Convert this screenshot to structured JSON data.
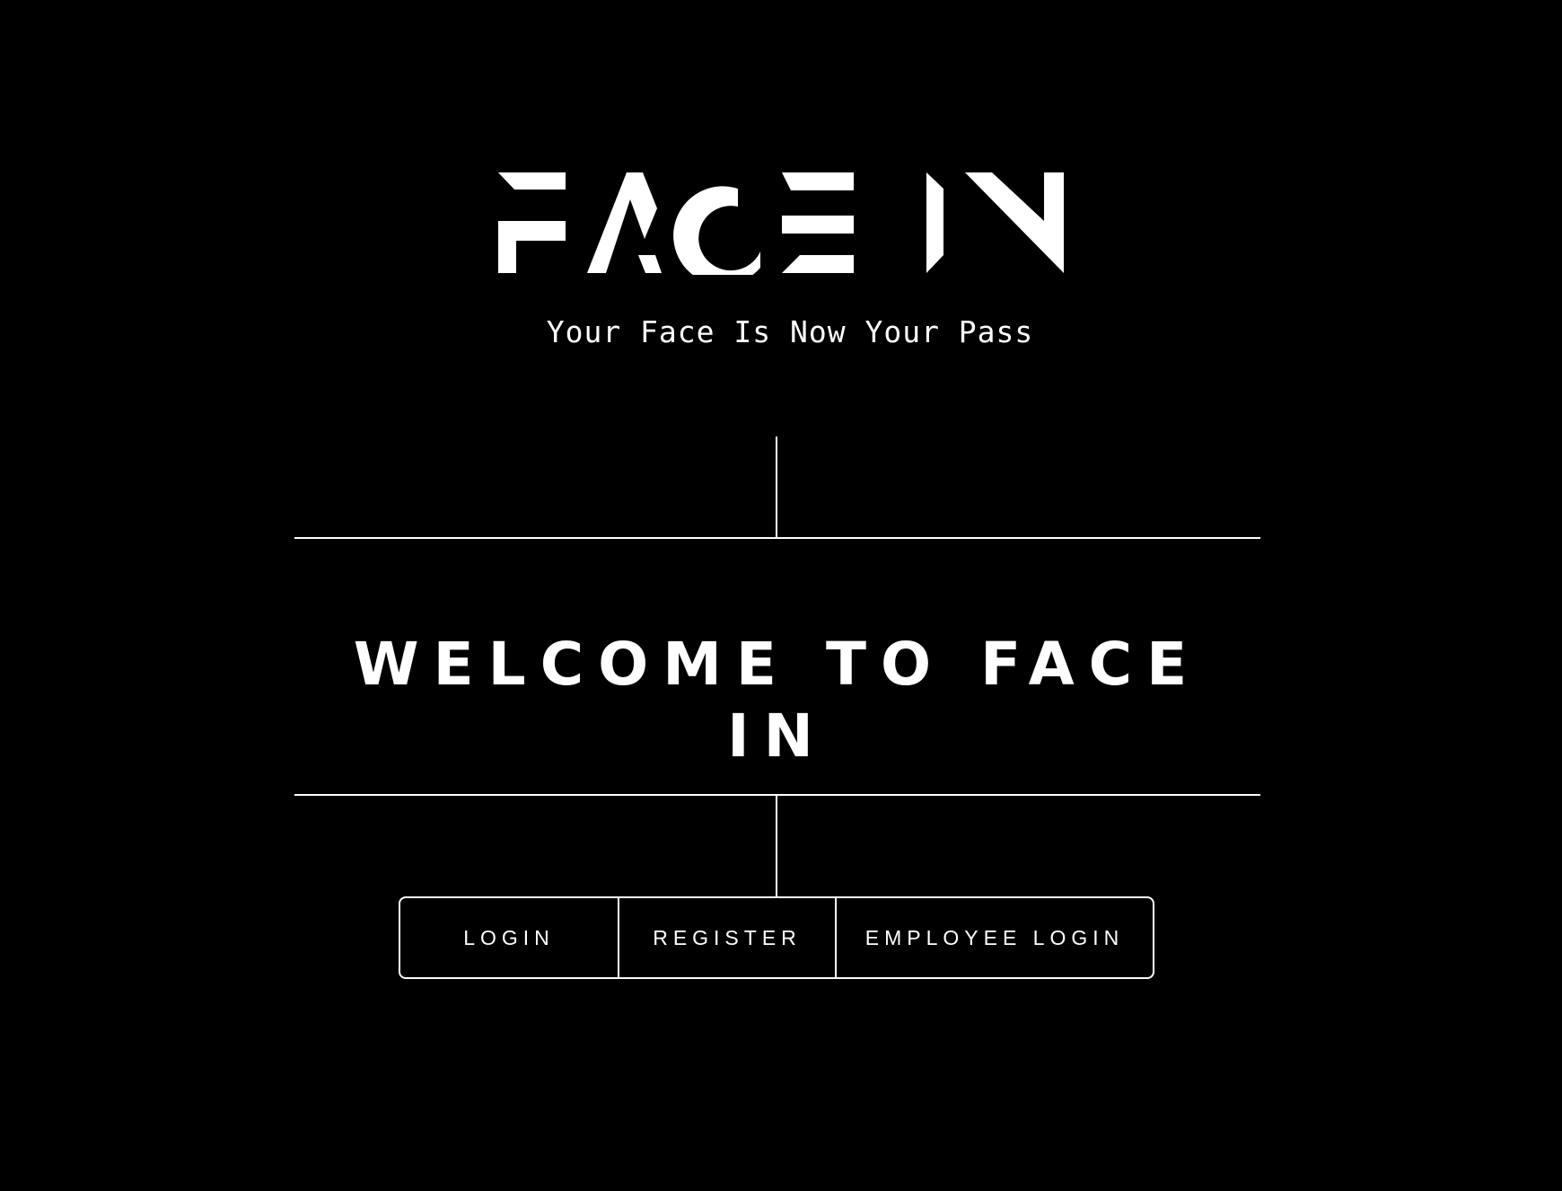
{
  "app": {
    "logo_text": "FACE IN",
    "tagline": "Your Face Is Now Your Pass"
  },
  "hero": {
    "welcome": "WELCOME TO FACE IN"
  },
  "actions": {
    "login_label": "LOGIN",
    "register_label": "REGISTER",
    "employee_login_label": "EMPLOYEE LOGIN"
  },
  "theme": {
    "background": "#000000",
    "foreground": "#ffffff"
  }
}
